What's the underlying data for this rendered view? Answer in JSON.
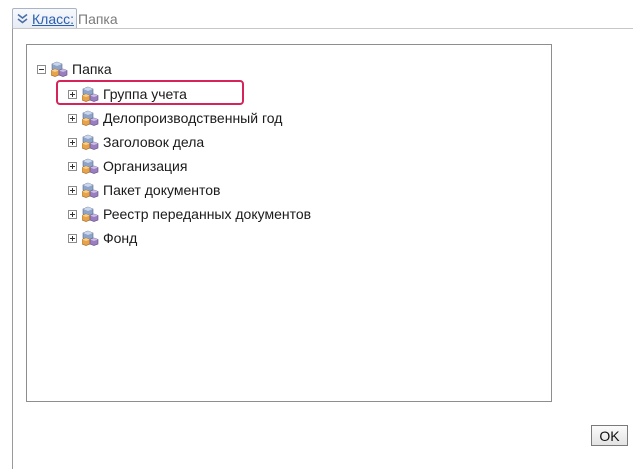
{
  "class_selector": {
    "label": "Класс:",
    "value": "Папка"
  },
  "tree": {
    "root": {
      "label": "Папка",
      "icon": "cube-icon"
    },
    "children": [
      {
        "label": "Группа учета",
        "highlighted": true
      },
      {
        "label": "Делопроизводственный год"
      },
      {
        "label": "Заголовок дела"
      },
      {
        "label": "Организация"
      },
      {
        "label": "Пакет документов"
      },
      {
        "label": "Реестр переданных документов"
      },
      {
        "label": "Фонд"
      }
    ]
  },
  "footer": {
    "ok_label": "OK"
  },
  "colors": {
    "highlight_border": "#d6245b",
    "link": "#2b5fb0"
  }
}
